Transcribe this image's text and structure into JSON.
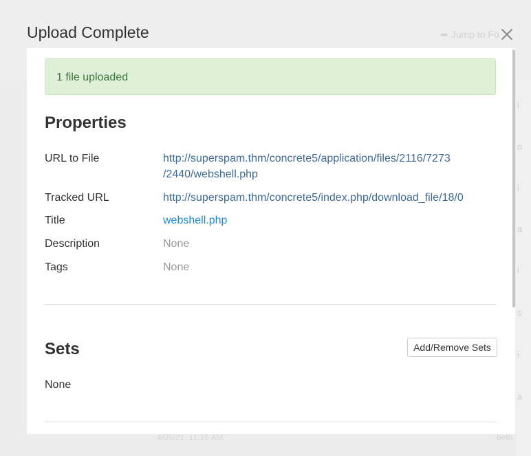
{
  "background": {
    "jump_label": "Jump to Fo",
    "right_fragments": [
      "i",
      "o",
      "i",
      "a",
      "i",
      "s",
      "i",
      "a"
    ],
    "bottom_date": "4/05/21, 11:16 AM",
    "bottom_right": "beth"
  },
  "dialog": {
    "title": "Upload Complete",
    "close_label": "Close"
  },
  "alert": {
    "message": "1 file uploaded"
  },
  "properties": {
    "heading": "Properties",
    "url_to_file_label": "URL to File",
    "url_to_file_line1": "http://superspam.thm/concrete5/application/files/2116/7273",
    "url_to_file_line2": "/2440/webshell.php",
    "tracked_url_label": "Tracked URL",
    "tracked_url": "http://superspam.thm/concrete5/index.php/download_file/18/0",
    "title_label": "Title",
    "title_value": "webshell.php",
    "description_label": "Description",
    "description_value": "None",
    "tags_label": "Tags",
    "tags_value": "None"
  },
  "sets": {
    "heading": "Sets",
    "add_remove_label": "Add/Remove Sets",
    "value": "None"
  },
  "colors": {
    "alert_bg": "#dff0d8",
    "alert_text": "#3c763d",
    "link": "#3e6a93",
    "link_bright": "#1d8ad0",
    "muted": "#999999"
  }
}
